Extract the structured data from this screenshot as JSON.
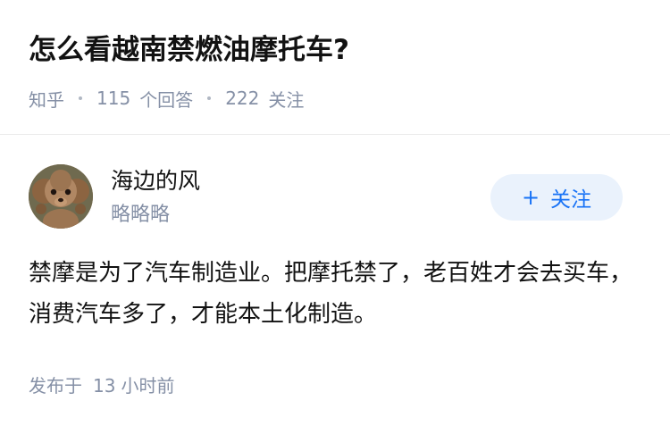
{
  "question": {
    "title": "怎么看越南禁燃油摩托车?",
    "source": "知乎",
    "answer_count": "115",
    "answer_label": "个回答",
    "follower_count": "222",
    "follower_label": "关注"
  },
  "answer": {
    "author": {
      "name": "海边的风",
      "bio": "略略略",
      "avatar_icon": "poodle-dog-avatar-icon"
    },
    "follow_button": {
      "icon": "+",
      "label": "关注"
    },
    "content": "禁摩是为了汽车制造业。把摩托禁了，老百姓才会去买车，消费汽车多了，才能本土化制造。",
    "posted_prefix": "发布于",
    "posted_number": "13",
    "posted_unit": "小时前"
  },
  "colors": {
    "accent": "#1772f6",
    "follow_bg": "#eaf2fc",
    "meta_text": "#8590a6",
    "title_text": "#121212"
  }
}
